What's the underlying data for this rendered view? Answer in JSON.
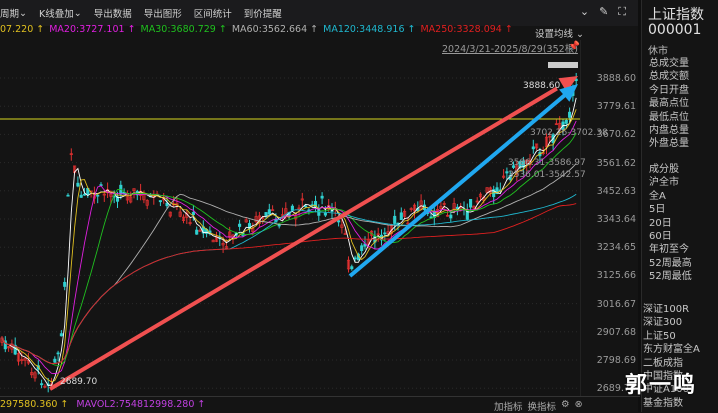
{
  "toolbar": {
    "items": [
      "周期",
      "K线叠加",
      "导出数据",
      "导出图形",
      "区间统计",
      "到价提醒"
    ],
    "icons": [
      "circle-chevron-icon",
      "brush-icon",
      "fullscreen-icon"
    ]
  },
  "ma": [
    {
      "label": "07.220 ↑",
      "color": "#e0c020"
    },
    {
      "label": "MA20:3727.101 ↑",
      "color": "#e020e0"
    },
    {
      "label": "MA30:3680.729 ↑",
      "color": "#20c020"
    },
    {
      "label": "MA60:3562.664 ↑",
      "color": "#b0b0b0"
    },
    {
      "label": "MA120:3448.916 ↑",
      "color": "#20b8d0"
    },
    {
      "label": "MA250:3328.094 ↑",
      "color": "#e02020"
    }
  ],
  "set_ma": "设置均线 ⌄",
  "range": "2024/3/21-2025/8/29(352根)",
  "axis": [
    "3888.60",
    "3779.61",
    "3670.62",
    "3561.62",
    "3452.63",
    "3343.64",
    "3234.65",
    "3125.66",
    "3016.67",
    "2907.68",
    "2798.69",
    "2689.70"
  ],
  "annotations": {
    "high": "3888.60",
    "low": "2689.70",
    "r1": "3702.26-3702.38",
    "r2": "3586.31-3586.97",
    "r3": "3536.01-3542.57"
  },
  "panel": {
    "title": "上证指数",
    "code": "000001",
    "status": "休市",
    "stats": [
      "总成交量",
      "总成交额",
      "今日开盘",
      "最高点位",
      "最低点位",
      "内盘总量",
      "外盘总量"
    ],
    "tabs": [
      "成分股",
      "沪全市",
      "全A",
      "5日",
      "20日",
      "60日",
      "年初至今",
      "52周最高",
      "52周最低"
    ],
    "indices": [
      "深证100R",
      "深证300",
      "上证50",
      "东方财富全A",
      "二板成指",
      "中国指数",
      "中证A100",
      "基金指数"
    ]
  },
  "bottom": [
    {
      "label": "297580.360 ↑",
      "color": "#e0c020"
    },
    {
      "label": "MAVOL2:754812998.280 ↑",
      "color": "#c040e0"
    }
  ],
  "bottom_buttons": [
    "加指标",
    "换指标"
  ],
  "watermark": "郭一鸣"
}
